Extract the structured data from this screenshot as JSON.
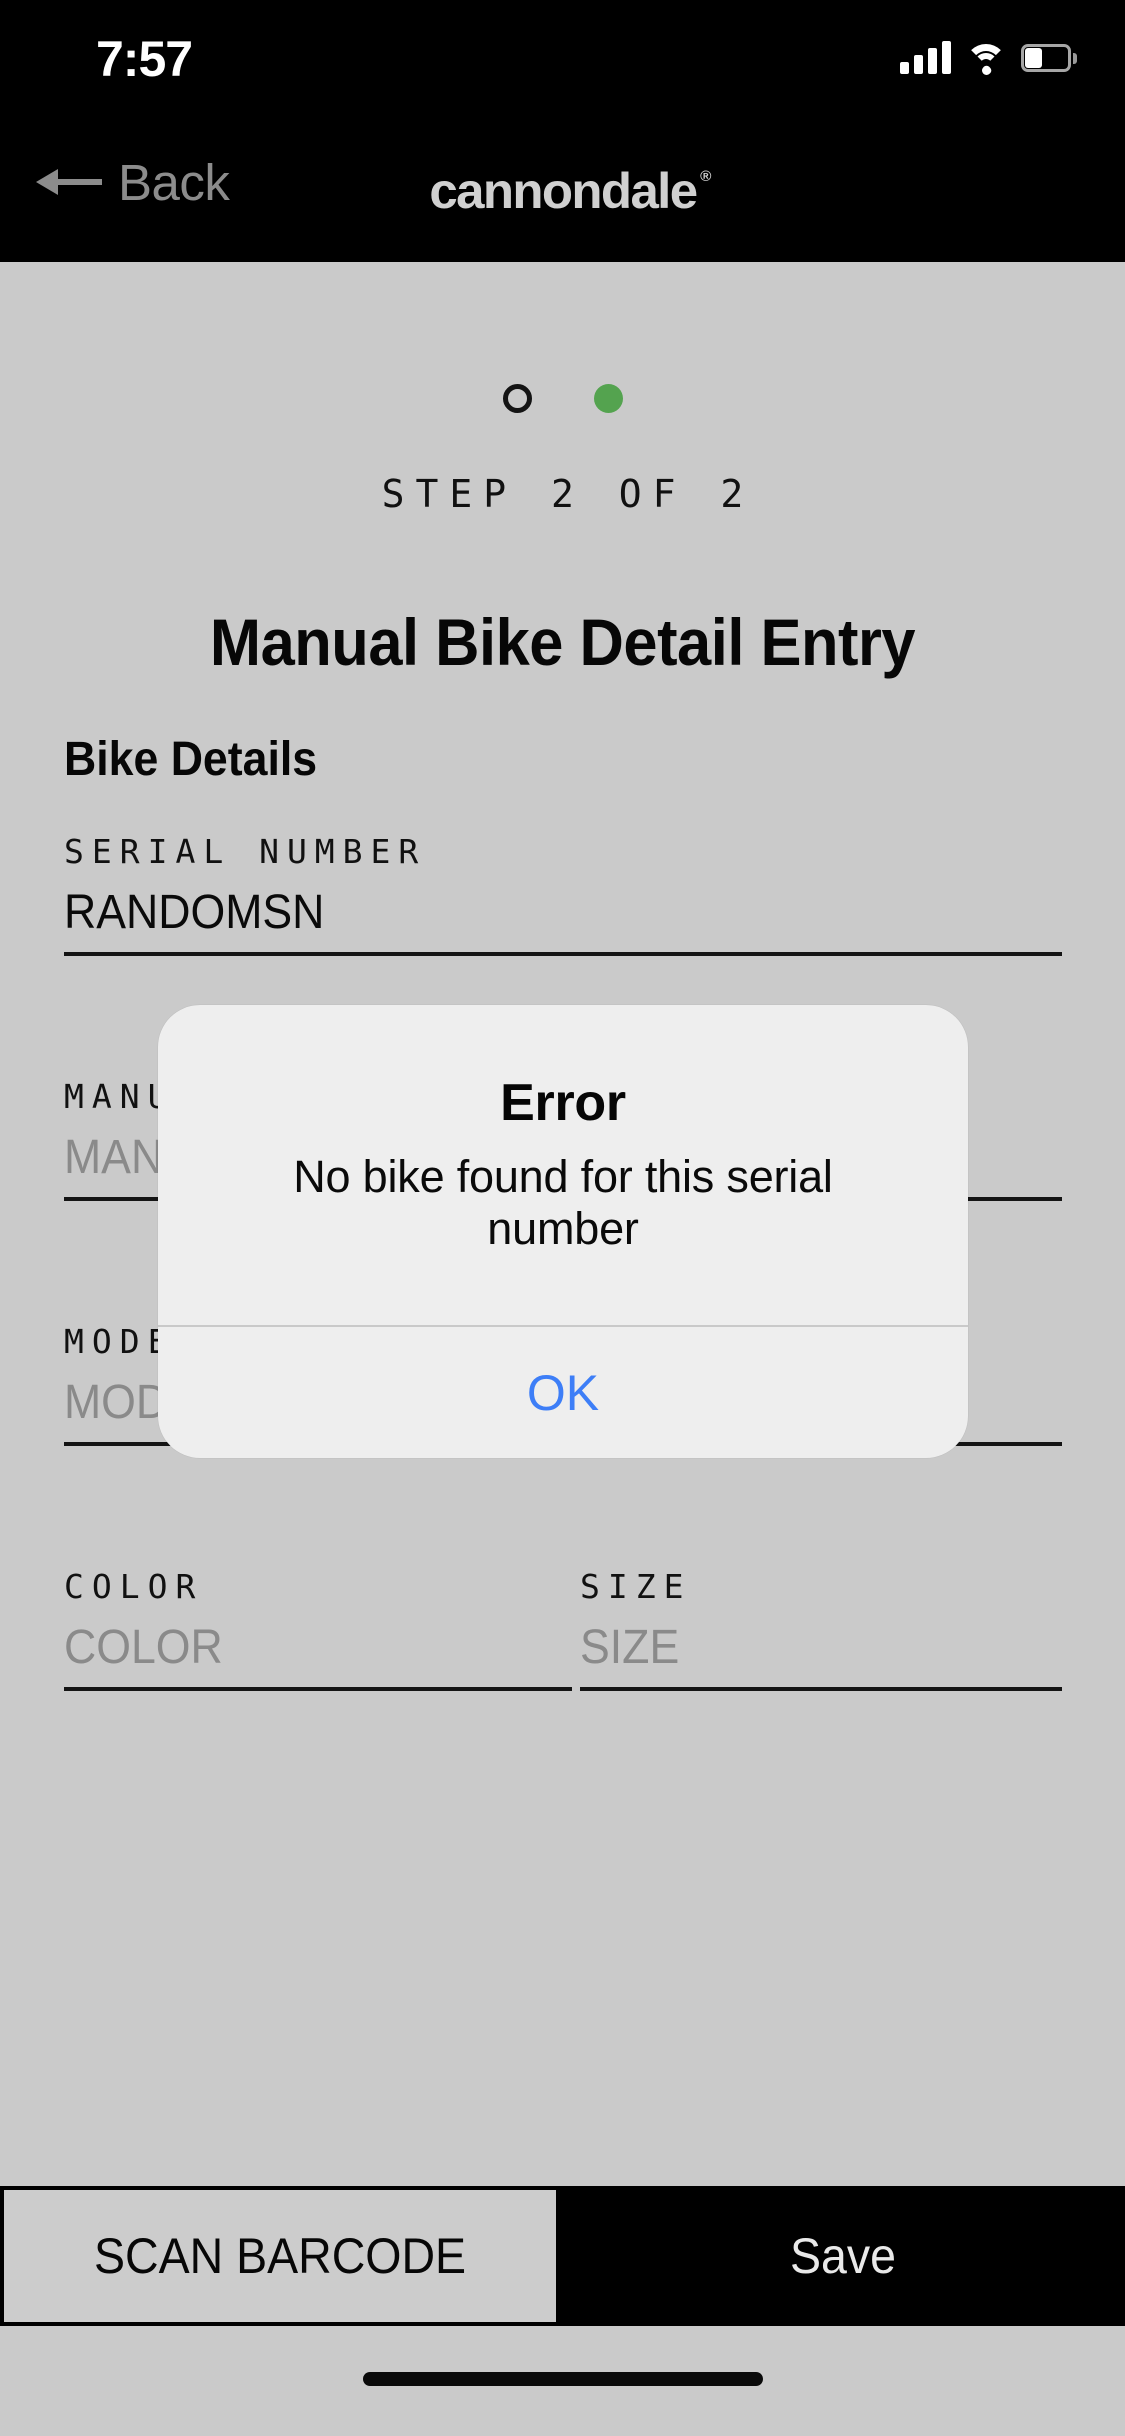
{
  "status_bar": {
    "time": "7:57",
    "signal_icon": "cellular-signal-icon",
    "wifi_icon": "wifi-icon",
    "battery_icon": "battery-icon",
    "battery_level_pct": 40
  },
  "nav_bar": {
    "back_label": "Back",
    "back_icon": "arrow-left-icon",
    "brand": "cannondale",
    "brand_trademark": "®"
  },
  "stepper": {
    "dots": [
      {
        "state": "inactive"
      },
      {
        "state": "active"
      }
    ],
    "label": "STEP 2 OF 2",
    "active_color": "#54a34f"
  },
  "page": {
    "title": "Manual Bike Detail Entry",
    "section_title": "Bike Details"
  },
  "form": {
    "serial_number": {
      "label": "SERIAL NUMBER",
      "value": "RANDOMSN",
      "placeholder": "SERIAL NUMBER"
    },
    "manufacturer": {
      "label": "MANUFACTURER",
      "value": "",
      "placeholder": "MANUFACTURER"
    },
    "model": {
      "label": "MODEL",
      "value": "",
      "placeholder": "MODEL"
    },
    "color": {
      "label": "COLOR",
      "value": "",
      "placeholder": "COLOR"
    },
    "size": {
      "label": "SIZE",
      "value": "",
      "placeholder": "SIZE"
    }
  },
  "dialog": {
    "title": "Error",
    "message": "No bike found for this serial number",
    "ok_label": "OK",
    "ok_color": "#3d7ef7"
  },
  "actions": {
    "scan_label": "SCAN BARCODE",
    "save_label": "Save"
  }
}
